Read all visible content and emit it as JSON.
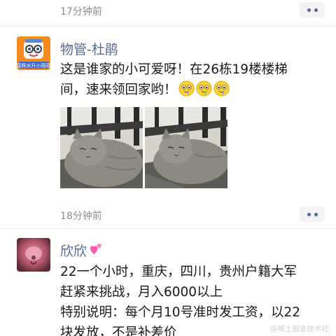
{
  "posts": [
    {
      "time": "17分钟前",
      "author": "",
      "text": []
    },
    {
      "time": "18分钟前",
      "author": "物管-杜鹃",
      "avatar_caption": "碧辉水升小瑕瑕",
      "text_line1": "这是谁家的小可爱呀！在26栋19楼楼梯",
      "text_line2": "间，速来领回家哟！",
      "emoji_icon": "drooling-face-emoji",
      "photos": [
        "cat-photo-1",
        "cat-photo-2"
      ]
    },
    {
      "author": "欣欣",
      "author_icon": "pink-hearts-emoji",
      "text": [
        "22一个小时，重庆，四川，贵州户籍大军",
        "赶紧来挑战，月入6000以上",
        "特别说明：每个月10号准时发工资，以22",
        "块发放，不是补差价"
      ]
    }
  ],
  "colors": {
    "nickname": "#576b95",
    "text": "#191919",
    "time": "#8c8c8c",
    "more_dot": "#56698f"
  },
  "watermark": "@稀土掘金技术社区"
}
